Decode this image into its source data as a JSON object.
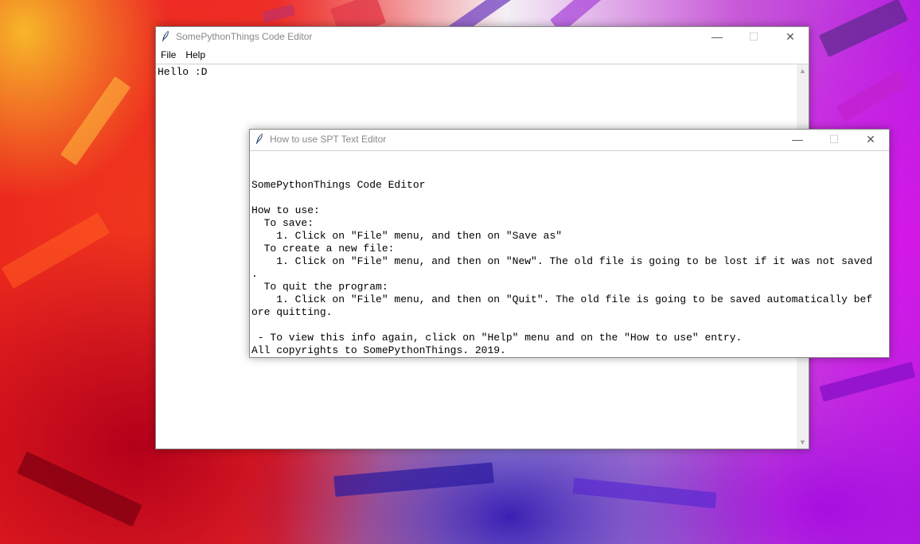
{
  "desktop": {},
  "main_window": {
    "title": "SomePythonThings Code Editor",
    "icon": "feather-icon",
    "menu": [
      "File",
      "Help"
    ],
    "editor_text": "Hello :D"
  },
  "help_window": {
    "title": "How to use SPT Text Editor",
    "icon": "feather-icon",
    "lines": [
      "SomePythonThings Code Editor",
      "",
      "How to use:",
      "  To save:",
      "    1. Click on \"File\" menu, and then on \"Save as\"",
      "  To create a new file:",
      "    1. Click on \"File\" menu, and then on \"New\". The old file is going to be lost if it was not saved",
      ".",
      "  To quit the program:",
      "    1. Click on \"File\" menu, and then on \"Quit\". The old file is going to be saved automatically bef",
      "ore quitting.",
      "",
      " - To view this info again, click on \"Help\" menu and on the \"How to use\" entry.",
      "All copyrights to SomePythonThings. 2019."
    ]
  },
  "window_controls": {
    "minimize_glyph": "—",
    "maximize_glyph": "☐",
    "close_glyph": "✕"
  },
  "scrollbar": {
    "up_glyph": "▲",
    "down_glyph": "▼"
  }
}
